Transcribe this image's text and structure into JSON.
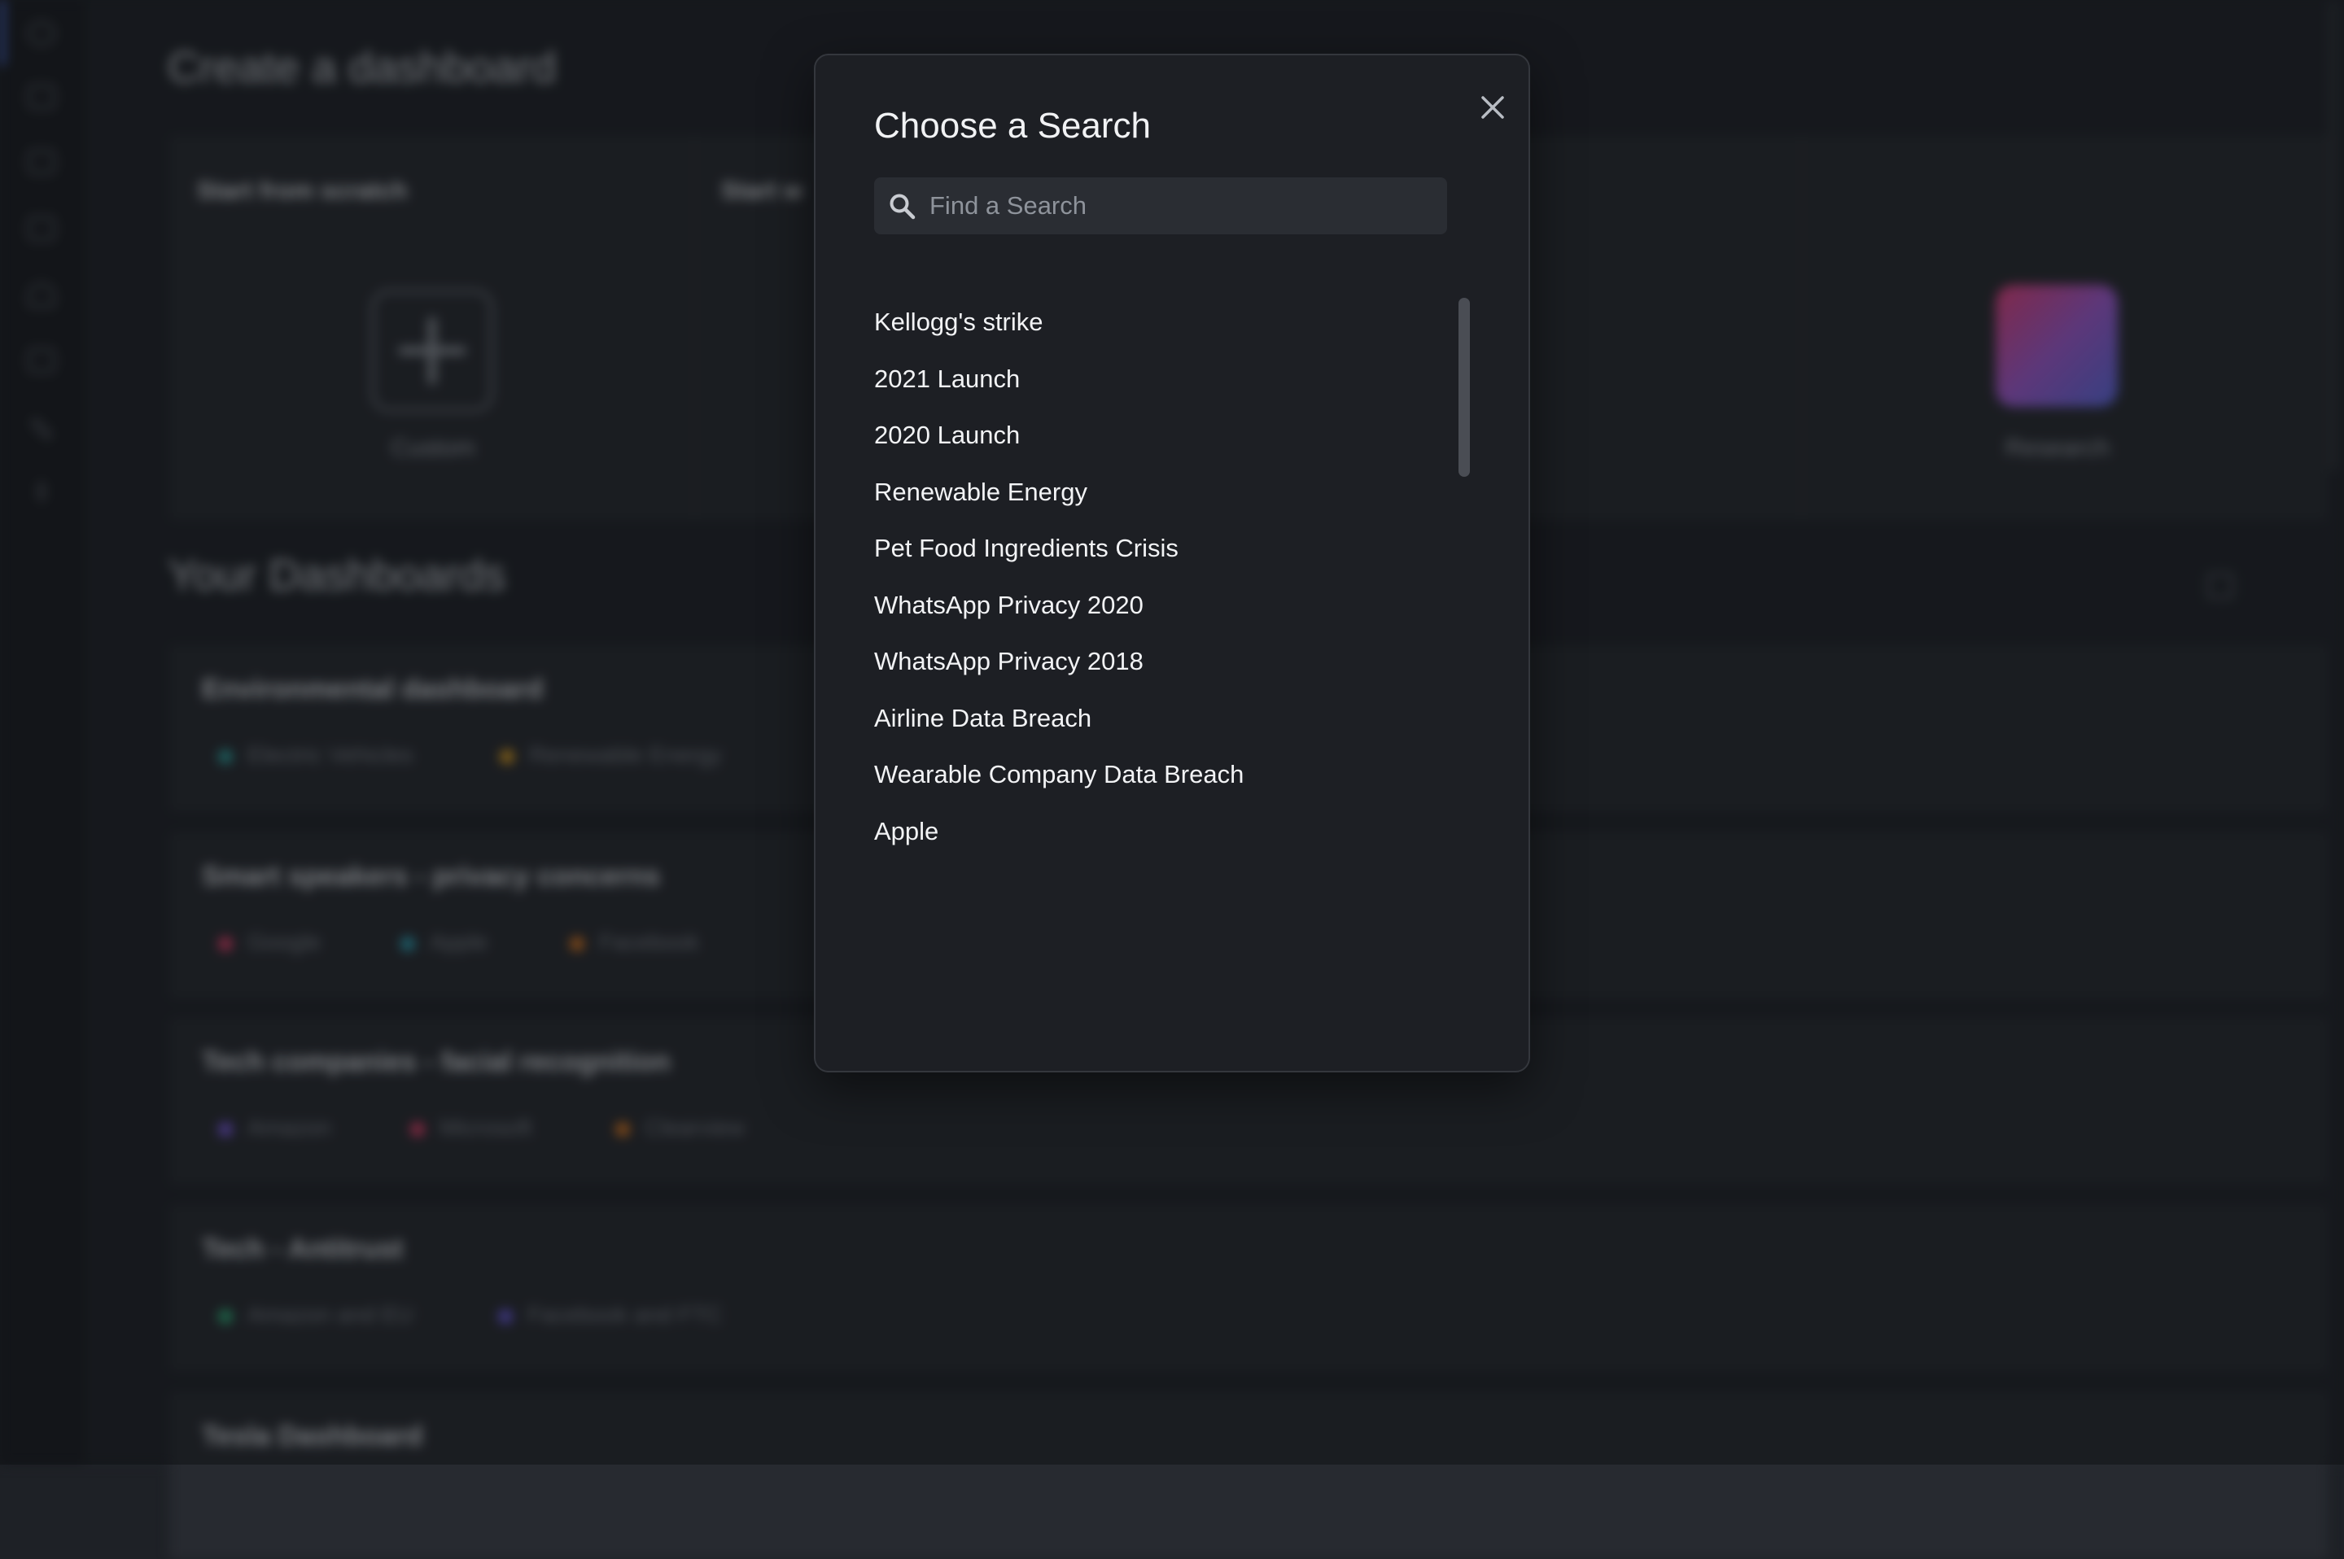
{
  "background": {
    "page_title": "Create a dashboard",
    "start_panel": {
      "columns": [
        {
          "label": "Start from scratch",
          "tile": "Custom"
        },
        {
          "label": "Start w",
          "tile": ""
        },
        {
          "label": "",
          "tile": ""
        },
        {
          "label": "",
          "tile": "Research"
        }
      ]
    },
    "your_dashboards_heading": "Your Dashboards",
    "dashboards": [
      {
        "title": "Environmental dashboard",
        "tags": [
          {
            "name": "Electric Vehicles",
            "color": "#2fa3a0"
          },
          {
            "name": "Renewable Energy",
            "color": "#e0a020"
          }
        ]
      },
      {
        "title": "Smart speakers - privacy concerns",
        "tags": [
          {
            "name": "Google",
            "color": "#e0406a"
          },
          {
            "name": "Apple",
            "color": "#2fa3b8"
          },
          {
            "name": "Facebook",
            "color": "#e07a20"
          }
        ]
      },
      {
        "title": "Tech companies - facial recognition",
        "tags": [
          {
            "name": "Amazon",
            "color": "#7a5ae0"
          },
          {
            "name": "Microsoft",
            "color": "#e0406a"
          },
          {
            "name": "Clearview",
            "color": "#e07a20"
          }
        ]
      },
      {
        "title": "Tech - Antitrust",
        "tags": [
          {
            "name": "Amazon and EU",
            "color": "#2fb07a"
          },
          {
            "name": "Facebook and FTC",
            "color": "#6a5ae0"
          }
        ]
      },
      {
        "title": "Tesla Dashboard",
        "tags": []
      }
    ]
  },
  "modal": {
    "title": "Choose a Search",
    "close_icon": "close-icon",
    "search": {
      "placeholder": "Find a Search",
      "value": "",
      "icon": "search-icon"
    },
    "results": [
      "Kellogg's strike",
      "2021 Launch",
      "2020 Launch",
      "Renewable Energy",
      "Pet Food Ingredients Crisis",
      "WhatsApp Privacy 2020",
      "WhatsApp Privacy 2018",
      "Airline Data Breach",
      "Wearable Company Data Breach",
      "Apple"
    ]
  },
  "colors": {
    "modal_background": "#1d1f24",
    "accent": "#4b6fe0"
  }
}
